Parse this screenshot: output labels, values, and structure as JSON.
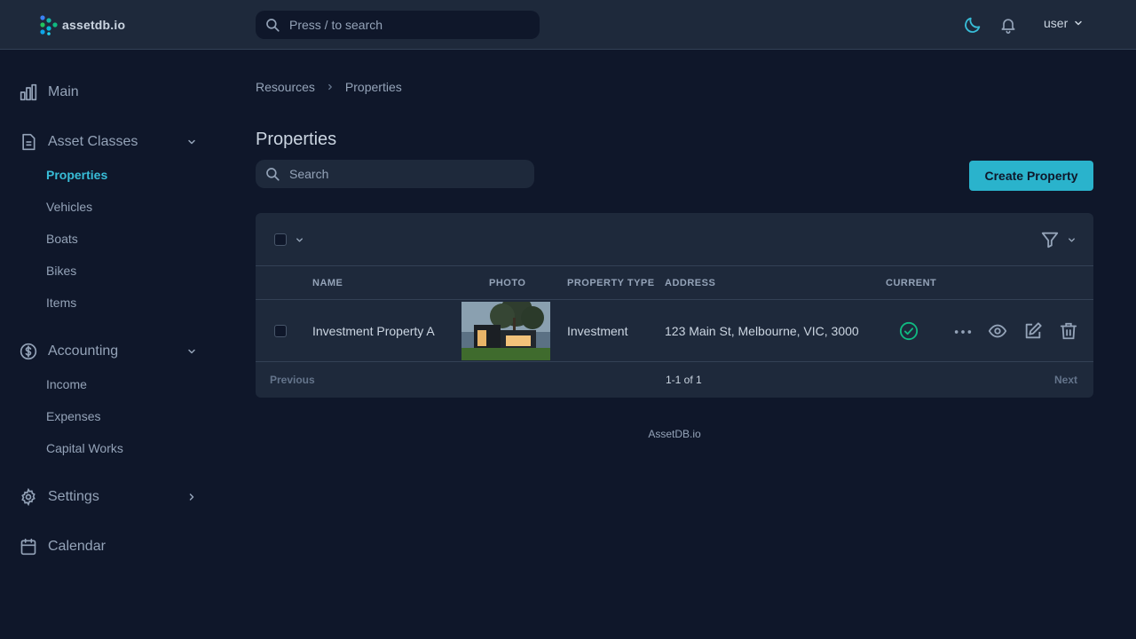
{
  "app": {
    "logo_text": "assetdb.io"
  },
  "header": {
    "search_placeholder": "Press / to search",
    "user_label": "user"
  },
  "sidebar": {
    "main": "Main",
    "asset_classes": "Asset Classes",
    "asset_items": [
      "Properties",
      "Vehicles",
      "Boats",
      "Bikes",
      "Items"
    ],
    "accounting": "Accounting",
    "accounting_items": [
      "Income",
      "Expenses",
      "Capital Works"
    ],
    "settings": "Settings",
    "calendar": "Calendar"
  },
  "breadcrumb": {
    "root": "Resources",
    "current": "Properties"
  },
  "page": {
    "title": "Properties",
    "search_placeholder": "Search",
    "create_label": "Create Property"
  },
  "table": {
    "columns": {
      "name": "NAME",
      "photo": "PHOTO",
      "type": "PROPERTY TYPE",
      "address": "ADDRESS",
      "current": "CURRENT"
    },
    "rows": [
      {
        "name": "Investment Property A",
        "type": "Investment",
        "address": "123 Main St, Melbourne, VIC, 3000",
        "current": true
      }
    ],
    "pagination": {
      "previous": "Previous",
      "summary": "1-1 of 1",
      "next": "Next"
    }
  },
  "footer": {
    "text": "AssetDB.io"
  },
  "colors": {
    "accent": "#2ab3cc",
    "background": "#0f172a",
    "surface": "#1e293b",
    "success": "#10b981"
  }
}
